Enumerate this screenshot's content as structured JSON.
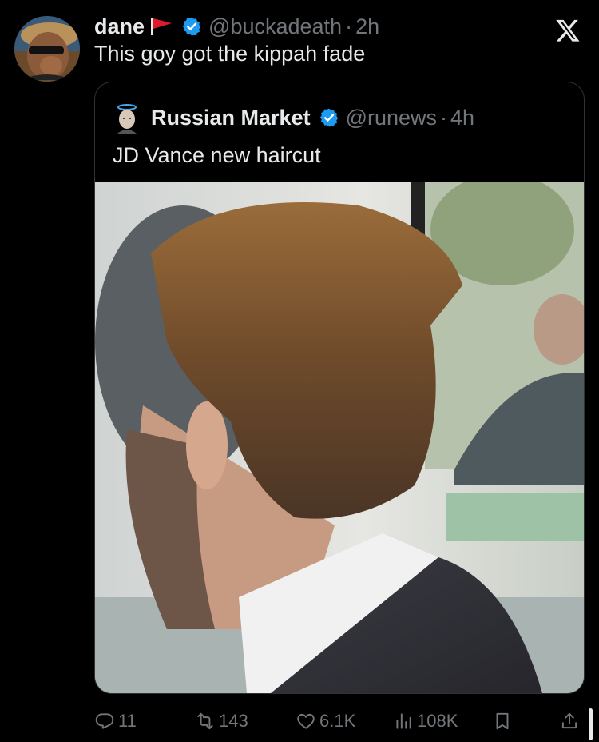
{
  "tweet": {
    "display_name": "dane",
    "flag_icon": "red-flag-icon",
    "handle": "@buckadeath",
    "separator": "·",
    "time": "2h",
    "text": "This goy got the kippah fade"
  },
  "quote": {
    "display_name": "Russian Market",
    "handle": "@runews",
    "separator": "·",
    "time": "4h",
    "text": "JD Vance new haircut"
  },
  "actions": {
    "replies": "11",
    "reposts": "143",
    "likes": "6.1K",
    "views": "108K"
  },
  "colors": {
    "background": "#000000",
    "text_primary": "#e7e9ea",
    "text_secondary": "#71767b",
    "verified": "#1d9bf0",
    "border": "#2f3336",
    "flag_red": "#e0192b"
  }
}
